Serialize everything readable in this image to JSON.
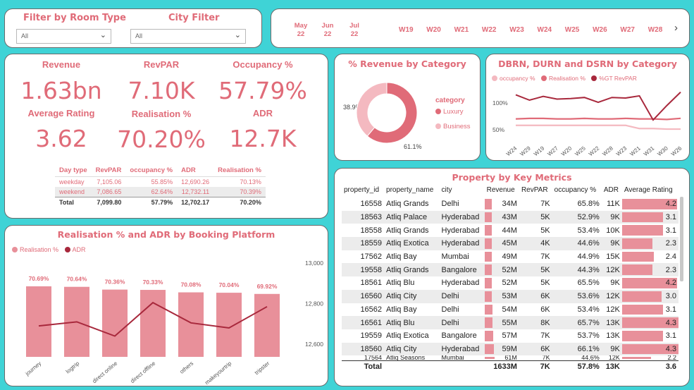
{
  "filters": {
    "room_type": {
      "title": "Filter by Room Type",
      "value": "All"
    },
    "city": {
      "title": "City Filter",
      "value": "All"
    }
  },
  "slicer": {
    "months": [
      {
        "m": "May",
        "y": "22"
      },
      {
        "m": "Jun",
        "y": "22"
      },
      {
        "m": "Jul",
        "y": "22"
      }
    ],
    "weeks": [
      "W19",
      "W20",
      "W21",
      "W22",
      "W23",
      "W24",
      "W25",
      "W26",
      "W27",
      "W28"
    ],
    "next_icon": "chevron-right-icon"
  },
  "kpis": {
    "revenue": {
      "label": "Revenue",
      "value": "1.63bn"
    },
    "revpar": {
      "label": "RevPAR",
      "value": "7.10K"
    },
    "occupancy": {
      "label": "Occupancy %",
      "value": "57.79%"
    },
    "avg_rating": {
      "label": "Average Rating",
      "value": "3.62"
    },
    "realisation": {
      "label": "Realisation %",
      "value": "70.20%"
    },
    "adr": {
      "label": "ADR",
      "value": "12.7K"
    }
  },
  "day_table": {
    "headers": [
      "Day type",
      "RevPAR",
      "occupancy %",
      "ADR",
      "Realisation %"
    ],
    "rows": [
      [
        "weekday",
        "7,105.06",
        "55.85%",
        "12,690.26",
        "70.13%"
      ],
      [
        "weekend",
        "7,086.65",
        "62.64%",
        "12,732.11",
        "70.39%"
      ]
    ],
    "total": [
      "Total",
      "7,099.80",
      "57.79%",
      "12,702.17",
      "70.20%"
    ]
  },
  "donut": {
    "title": "% Revenue by Category",
    "legend_title": "category",
    "colors": {
      "Luxury": "#e06b78",
      "Business": "#f4b9c0"
    },
    "chart_data": {
      "type": "pie",
      "categories": [
        "Luxury",
        "Business"
      ],
      "values": [
        61.1,
        38.9
      ],
      "labels": [
        "61.1%",
        "38.9%"
      ]
    }
  },
  "dbrn": {
    "title": "DBRN, DURN and DSRN by Category",
    "legend": [
      "occupancy %",
      "Realisation %",
      "%GT RevPAR"
    ],
    "colors": [
      "#f4b9c0",
      "#e06b78",
      "#a8283c"
    ],
    "chart_data": {
      "type": "line",
      "x": [
        "W24",
        "W29",
        "W19",
        "W27",
        "W20",
        "W25",
        "W22",
        "W28",
        "W23",
        "W21",
        "W31",
        "W30",
        "W26"
      ],
      "yticks": [
        "100%",
        "50%"
      ],
      "series": [
        {
          "name": "occupancy %",
          "values": [
            58,
            58,
            58,
            58,
            58,
            58,
            58,
            58,
            58,
            52,
            52,
            51,
            51
          ]
        },
        {
          "name": "Realisation %",
          "values": [
            70,
            71,
            71,
            70,
            70,
            71,
            70,
            70,
            71,
            70,
            70,
            69,
            71
          ]
        },
        {
          "name": "%GT RevPAR",
          "values": [
            115,
            105,
            112,
            107,
            108,
            110,
            101,
            110,
            109,
            113,
            68,
            95,
            120
          ]
        }
      ]
    }
  },
  "property": {
    "title": "Property by Key Metrics",
    "headers": [
      "property_id",
      "property_name",
      "city",
      "Revenue",
      "RevPAR",
      "occupancy %",
      "ADR",
      "Average Rating"
    ],
    "rows": [
      [
        "16558",
        "Atliq Grands",
        "Delhi",
        "34M",
        "7K",
        "65.8%",
        "11K",
        "4.2"
      ],
      [
        "18563",
        "Atliq Palace",
        "Hyderabad",
        "43M",
        "5K",
        "52.9%",
        "9K",
        "3.1"
      ],
      [
        "18558",
        "Atliq Grands",
        "Hyderabad",
        "44M",
        "5K",
        "53.4%",
        "10K",
        "3.1"
      ],
      [
        "18559",
        "Atliq Exotica",
        "Hyderabad",
        "45M",
        "4K",
        "44.6%",
        "9K",
        "2.3"
      ],
      [
        "17562",
        "Atliq Bay",
        "Mumbai",
        "49M",
        "7K",
        "44.9%",
        "15K",
        "2.4"
      ],
      [
        "19558",
        "Atliq Grands",
        "Bangalore",
        "52M",
        "5K",
        "44.3%",
        "12K",
        "2.3"
      ],
      [
        "18561",
        "Atliq Blu",
        "Hyderabad",
        "52M",
        "5K",
        "65.5%",
        "9K",
        "4.2"
      ],
      [
        "16560",
        "Atliq City",
        "Delhi",
        "53M",
        "6K",
        "53.6%",
        "12K",
        "3.0"
      ],
      [
        "16562",
        "Atliq Bay",
        "Delhi",
        "54M",
        "6K",
        "53.4%",
        "12K",
        "3.1"
      ],
      [
        "16561",
        "Atliq Blu",
        "Delhi",
        "55M",
        "8K",
        "65.7%",
        "13K",
        "4.3"
      ],
      [
        "19559",
        "Atliq Exotica",
        "Bangalore",
        "57M",
        "7K",
        "53.7%",
        "13K",
        "3.1"
      ],
      [
        "18560",
        "Atliq City",
        "Hyderabad",
        "59M",
        "6K",
        "66.1%",
        "9K",
        "4.3"
      ]
    ],
    "partial_row": [
      "17564",
      "Atliq Seasons",
      "Mumbai",
      "61M",
      "7K",
      "44.6%",
      "12K",
      "2.2"
    ],
    "total": [
      "Total",
      "",
      "",
      "1633M",
      "7K",
      "57.8%",
      "13K",
      "3.6"
    ]
  },
  "platform": {
    "title": "Realisation % and ADR by Booking Platform",
    "legend": [
      "Realisation %",
      "ADR"
    ],
    "colors": [
      "#e8909a",
      "#a8283c"
    ],
    "chart_data": {
      "type": "bar",
      "categories": [
        "journey",
        "logtrip",
        "direct online",
        "direct offline",
        "others",
        "makeyourtrip",
        "tripster"
      ],
      "series": [
        {
          "name": "Realisation %",
          "values": [
            70.69,
            70.64,
            70.36,
            70.33,
            70.08,
            70.04,
            69.92
          ],
          "labels": [
            "70.69%",
            "70.64%",
            "70.36%",
            "70.33%",
            "70.08%",
            "70.04%",
            "69.92%"
          ]
        },
        {
          "name": "ADR",
          "values": [
            12690,
            12710,
            12640,
            12805,
            12705,
            12680,
            12785
          ]
        }
      ],
      "y2ticks": [
        "13,000",
        "12,800",
        "12,600"
      ],
      "y2lim": [
        12600,
        13000
      ]
    }
  }
}
